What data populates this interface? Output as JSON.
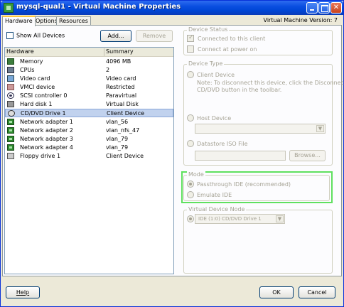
{
  "window": {
    "title": "mysql-qual1 - Virtual Machine Properties",
    "icon": "vm-icon",
    "controls": [
      "minimize",
      "maximize",
      "close"
    ],
    "version_text": "Virtual Machine Version: 7"
  },
  "tabs": [
    {
      "label": "Hardware",
      "active": true
    },
    {
      "label": "Options",
      "active": false
    },
    {
      "label": "Resources",
      "active": false
    }
  ],
  "hardware_panel": {
    "show_all_devices_label": "Show All Devices",
    "show_all_devices_checked": false,
    "add_label": "Add...",
    "remove_label": "Remove",
    "columns": [
      "Hardware",
      "Summary"
    ],
    "rows": [
      {
        "icon": "memory-icon",
        "name": "Memory",
        "summary": "4096 MB",
        "selected": false
      },
      {
        "icon": "cpu-icon",
        "name": "CPUs",
        "summary": "2",
        "selected": false
      },
      {
        "icon": "video-card-icon",
        "name": "Video card",
        "summary": "Video card",
        "selected": false
      },
      {
        "icon": "vmci-device-icon",
        "name": "VMCI device",
        "summary": "Restricted",
        "selected": false
      },
      {
        "icon": "scsi-controller-icon",
        "name": "SCSI controller 0",
        "summary": "Paravirtual",
        "selected": false
      },
      {
        "icon": "hard-disk-icon",
        "name": "Hard disk 1",
        "summary": "Virtual Disk",
        "selected": false
      },
      {
        "icon": "cd-dvd-drive-icon",
        "name": "CD/DVD Drive 1",
        "summary": "Client Device",
        "selected": true
      },
      {
        "icon": "network-adapter-icon",
        "name": "Network adapter 1",
        "summary": "vlan_56",
        "selected": false
      },
      {
        "icon": "network-adapter-icon",
        "name": "Network adapter 2",
        "summary": "vlan_nfs_47",
        "selected": false
      },
      {
        "icon": "network-adapter-icon",
        "name": "Network adapter 3",
        "summary": "vlan_79",
        "selected": false
      },
      {
        "icon": "network-adapter-icon",
        "name": "Network adapter 4",
        "summary": "vlan_79",
        "selected": false
      },
      {
        "icon": "floppy-drive-icon",
        "name": "Floppy drive 1",
        "summary": "Client Device",
        "selected": false
      }
    ]
  },
  "device_status": {
    "label": "Device Status",
    "connected_label": "Connected to this client",
    "connected_checked": true,
    "connect_at_power_on_label": "Connect at power on",
    "connect_at_power_on_checked": false
  },
  "device_type": {
    "label": "Device Type",
    "client_device_label": "Client Device",
    "client_device_note": "Note: To disconnect this device, click the Disconnect",
    "client_device_note2": "CD/DVD button in the toolbar.",
    "host_device_label": "Host Device",
    "host_device_value": "",
    "datastore_iso_label": "Datastore ISO File",
    "datastore_iso_value": "",
    "browse_label": "Browse..."
  },
  "mode": {
    "label": "Mode",
    "passthrough_label": "Passthrough IDE (recommended)",
    "passthrough_checked": true,
    "emulate_label": "Emulate IDE",
    "emulate_checked": false,
    "highlight_color": "#5fe05f"
  },
  "virtual_device_node": {
    "label": "Virtual Device Node",
    "value": "IDE (1:0) CD/DVD Drive 1"
  },
  "footer": {
    "help_label": "Help",
    "ok_label": "OK",
    "cancel_label": "Cancel"
  },
  "colors": {
    "title_bar": "#0a4ee0",
    "window_face": "#ece9d8",
    "selection": "#c1d2ee",
    "disabled_text": "#a5a294"
  }
}
